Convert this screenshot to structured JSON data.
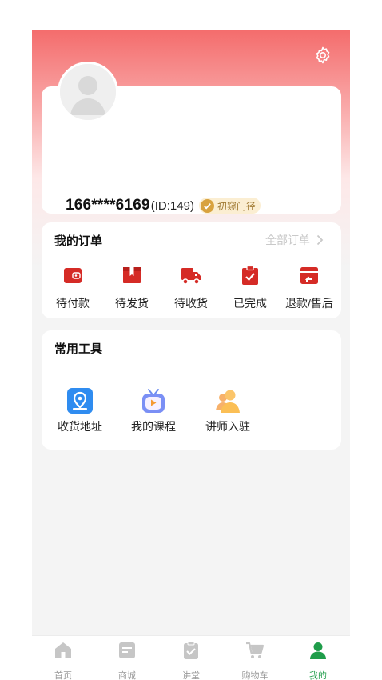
{
  "profile": {
    "phone": "166****6169",
    "id_text": "(ID:149)",
    "level_label": "初窥门径"
  },
  "orders": {
    "title": "我的订单",
    "all_label": "全部订单",
    "items": [
      {
        "label": "待付款",
        "icon": "wallet-icon"
      },
      {
        "label": "待发货",
        "icon": "package-icon"
      },
      {
        "label": "待收货",
        "icon": "truck-icon"
      },
      {
        "label": "已完成",
        "icon": "clipboard-check-icon"
      },
      {
        "label": "退款/售后",
        "icon": "refund-icon"
      }
    ]
  },
  "tools": {
    "title": "常用工具",
    "items": [
      {
        "label": "收货地址",
        "icon": "address-icon"
      },
      {
        "label": "我的课程",
        "icon": "course-tv-icon"
      },
      {
        "label": "讲师入驻",
        "icon": "lecturer-icon"
      }
    ]
  },
  "tabbar": {
    "items": [
      {
        "label": "首页",
        "icon": "home-icon"
      },
      {
        "label": "商城",
        "icon": "mall-icon"
      },
      {
        "label": "讲堂",
        "icon": "lecture-icon"
      },
      {
        "label": "购物车",
        "icon": "cart-icon"
      },
      {
        "label": "我的",
        "icon": "user-icon"
      }
    ],
    "active_index": 4
  },
  "colors": {
    "brand_red": "#d52b26",
    "accent_green": "#1f9d4a",
    "tool_blue": "#2f8cf0",
    "badge_gold": "#d8a23f"
  }
}
